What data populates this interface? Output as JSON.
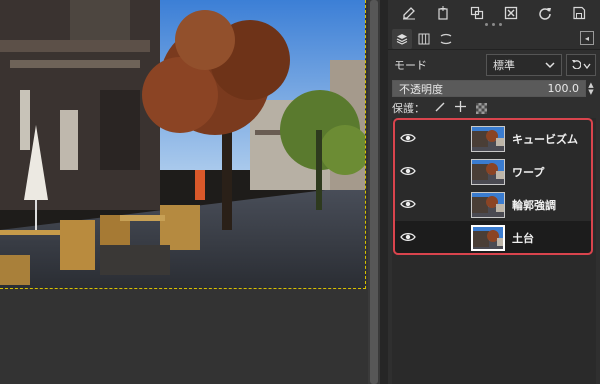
{
  "canvas": {
    "image_alt_icon": "photo-canvas"
  },
  "toolbar": {
    "icons": [
      "edit-icon",
      "new-layer-icon",
      "duplicate-icon",
      "close-icon",
      "refresh-icon",
      "save-icon"
    ]
  },
  "tabs": {
    "items": [
      "layers-tab-icon",
      "channels-tab-icon",
      "paths-tab-icon"
    ],
    "menu_icon": "tab-menu-icon"
  },
  "mode": {
    "label": "モード",
    "value": "標準"
  },
  "opacity": {
    "label": "不透明度",
    "value": "100.0",
    "level_percent": 100
  },
  "lock": {
    "label": "保護："
  },
  "layers": [
    {
      "name": "キュービズム",
      "visible": true,
      "selected": false
    },
    {
      "name": "ワープ",
      "visible": true,
      "selected": false
    },
    {
      "name": "輪郭強調",
      "visible": true,
      "selected": false
    },
    {
      "name": "土台",
      "visible": true,
      "selected": true
    }
  ],
  "colors": {
    "highlight": "#d9444d",
    "canvas_boundary": "#d8c200"
  }
}
